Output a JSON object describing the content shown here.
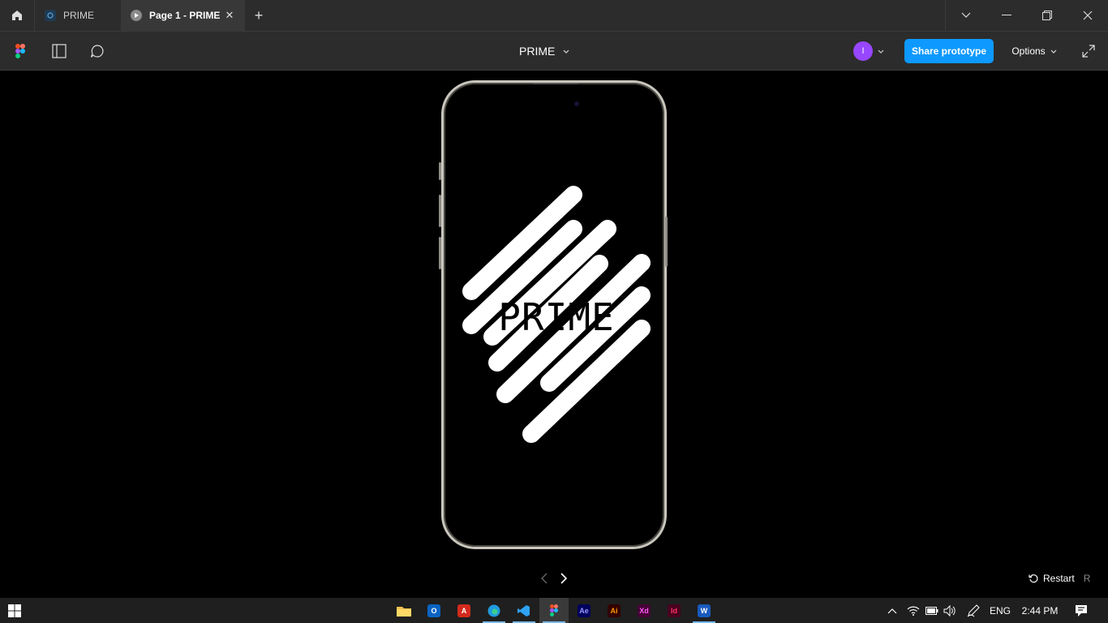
{
  "tabs": [
    {
      "label": "PRIME"
    },
    {
      "label": "Page 1 - PRIME"
    }
  ],
  "toolbar": {
    "file_title": "PRIME",
    "avatar_initial": "I",
    "share_label": "Share prototype",
    "options_label": "Options"
  },
  "prototype": {
    "logo_text": "PRIME"
  },
  "restart": {
    "label": "Restart",
    "shortcut": "R"
  },
  "taskbar": {
    "apps": [
      {
        "name": "File Explorer"
      },
      {
        "name": "Outlook"
      },
      {
        "name": "Acrobat"
      },
      {
        "name": "Edge"
      },
      {
        "name": "VS Code"
      },
      {
        "name": "Figma"
      },
      {
        "name": "After Effects",
        "tile": "Ae"
      },
      {
        "name": "Illustrator",
        "tile": "Ai"
      },
      {
        "name": "XD",
        "tile": "Xd"
      },
      {
        "name": "InDesign",
        "tile": "Id"
      },
      {
        "name": "Word",
        "tile": "W"
      }
    ],
    "language": "ENG",
    "time": "2:44 PM"
  },
  "colors": {
    "accent": "#0d99ff",
    "avatar": "#9747ff",
    "chrome_bg": "#2c2c2c",
    "canvas_bg": "#000000"
  }
}
